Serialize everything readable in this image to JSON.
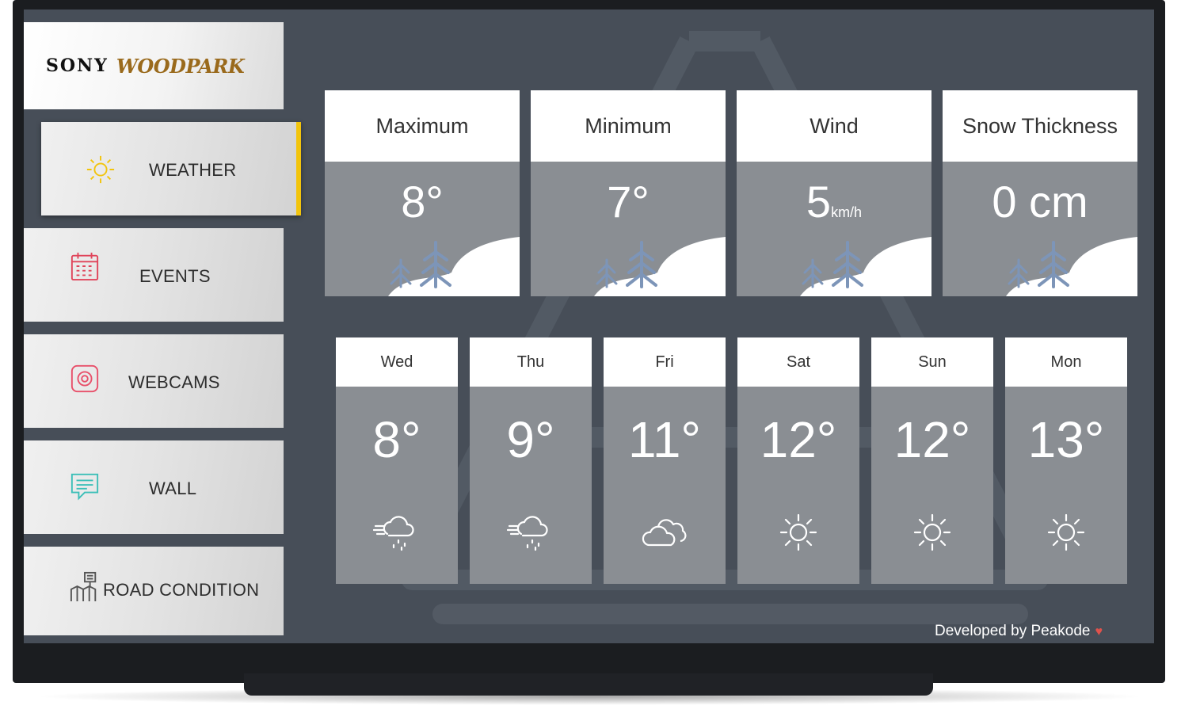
{
  "brand": {
    "sony": "SONY",
    "woodpark": "WOODPARK"
  },
  "menu": [
    {
      "label": "WEATHER",
      "icon": "sun-icon",
      "active": true
    },
    {
      "label": "EVENTS",
      "icon": "calendar-icon",
      "active": false
    },
    {
      "label": "WEBCAMS",
      "icon": "webcam-icon",
      "active": false
    },
    {
      "label": "WALL",
      "icon": "chat-icon",
      "active": false
    },
    {
      "label": "ROAD CONDITION",
      "icon": "road-sign-icon",
      "active": false
    }
  ],
  "stats": [
    {
      "title": "Maximum",
      "value": "8°",
      "unit": ""
    },
    {
      "title": "Minimum",
      "value": "7°",
      "unit": ""
    },
    {
      "title": "Wind",
      "value": "5",
      "unit": "km/h"
    },
    {
      "title": "Snow Thickness",
      "value": "0 cm",
      "unit": ""
    }
  ],
  "forecast": [
    {
      "day": "Wed",
      "temp": "8°",
      "icon": "snow-wind-icon"
    },
    {
      "day": "Thu",
      "temp": "9°",
      "icon": "snow-wind-icon"
    },
    {
      "day": "Fri",
      "temp": "11°",
      "icon": "cloud-icon"
    },
    {
      "day": "Sat",
      "temp": "12°",
      "icon": "sun-icon"
    },
    {
      "day": "Sun",
      "temp": "12°",
      "icon": "sun-icon"
    },
    {
      "day": "Mon",
      "temp": "13°",
      "icon": "sun-icon"
    }
  ],
  "footer": {
    "credit": "Developed by Peakode",
    "heart": "♥"
  },
  "colors": {
    "accent": "#f2c40c",
    "screen_bg": "#474e58",
    "card_body": "#8a8e93",
    "brand_gold": "#9a6a1c"
  }
}
